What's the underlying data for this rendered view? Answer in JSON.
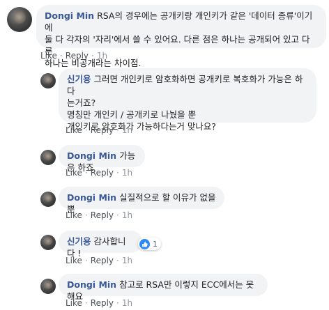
{
  "actions": {
    "like": "Like",
    "reply": "Reply",
    "separator": "·"
  },
  "comments": [
    {
      "author": "Dongi Min",
      "text": "RSA의 경우에는 공개키랑 개인키가 같은 '데이터 종류'이기에\n둘 다 각자의 '자리'에서 쓸 수 있어요. 다른 점은 하나는 공개되어 있고 다른\n하나는 비공개라는 차이점.",
      "time": "1h"
    },
    {
      "author": "신기용",
      "text": "그러면 개인키로 암호화하면 공개키로 복호화가 가능은 하다\n는거죠?\n명칭만 개인키 / 공개키로 나눴을 뿐\n개인키로 암호화가 가능하다는거 맞나요?",
      "time": "1h"
    },
    {
      "author": "Dongi Min",
      "text": "가능은 하죠",
      "time": "1h"
    },
    {
      "author": "Dongi Min",
      "text": "실질적으로 할 이유가 없을뿐",
      "time": "1h"
    },
    {
      "author": "신기용",
      "text": "감사합니다 !",
      "time": "1h",
      "reaction_count": "1"
    },
    {
      "author": "Dongi Min",
      "text": "참고로 RSA만 이렇지 ECC에서는 못해요",
      "time": "1h"
    }
  ]
}
